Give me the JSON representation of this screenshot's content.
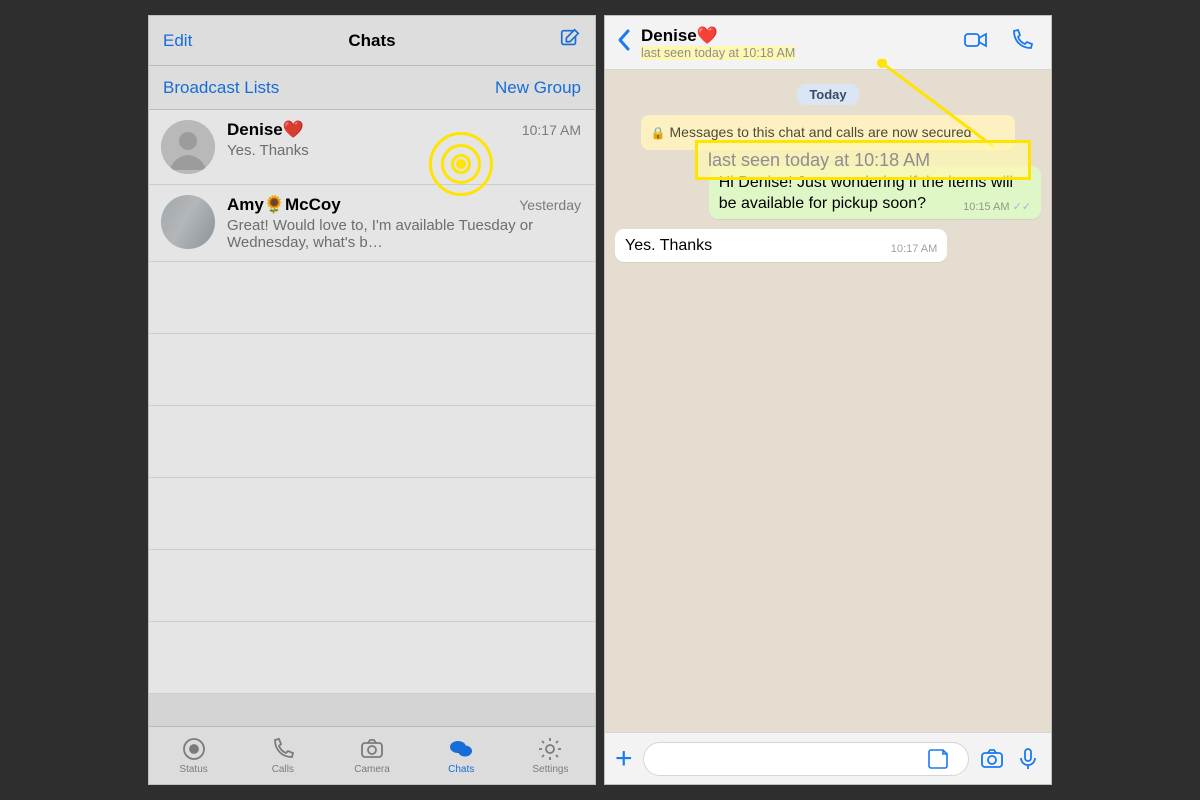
{
  "left": {
    "nav": {
      "edit": "Edit",
      "title": "Chats"
    },
    "subhead": {
      "broadcast": "Broadcast Lists",
      "newgroup": "New Group"
    },
    "chats": [
      {
        "name": "Denise❤️",
        "time": "10:17 AM",
        "preview": "Yes. Thanks"
      },
      {
        "name": "Amy🌻McCoy",
        "time": "Yesterday",
        "preview": "Great!  Would love to, I'm available Tuesday or Wednesday, what's b…"
      }
    ],
    "tabs": {
      "status": "Status",
      "calls": "Calls",
      "camera": "Camera",
      "chats": "Chats",
      "settings": "Settings"
    }
  },
  "right": {
    "contact": {
      "name": "Denise❤️",
      "status": "last seen today at 10:18 AM"
    },
    "day_label": "Today",
    "system_banner": "Messages to this chat and calls are now secured",
    "callout_text": "last seen today at 10:18 AM",
    "messages": [
      {
        "dir": "out",
        "text": "Hi Denise! Just wondering if the items will be available for pickup soon?",
        "time": "10:15 AM"
      },
      {
        "dir": "in",
        "text": "Yes. Thanks",
        "time": "10:17 AM"
      }
    ],
    "input_placeholder": ""
  }
}
